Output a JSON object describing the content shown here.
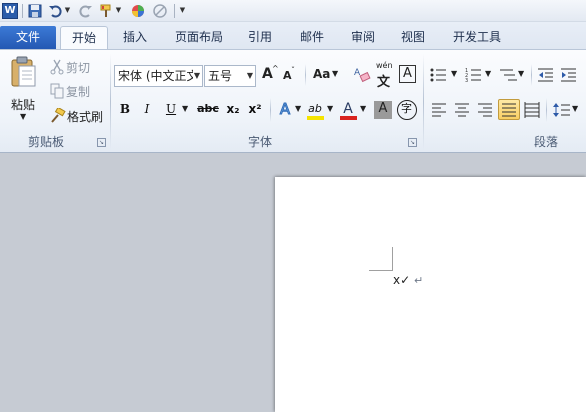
{
  "qat": {
    "app_icon_letter": "W",
    "icons": [
      "word-app-icon",
      "save-icon",
      "undo-icon",
      "redo-icon",
      "format-painter-icon",
      "color-wheel-icon",
      "no-sign-icon",
      "customize-toolbar-icon"
    ]
  },
  "tabs": {
    "file": "文件",
    "home": "开始",
    "insert": "插入",
    "page_layout": "页面布局",
    "references": "引用",
    "mailings": "邮件",
    "review": "审阅",
    "view": "视图",
    "developer": "开发工具"
  },
  "clipboard": {
    "paste": "粘贴",
    "cut": "剪切",
    "copy": "复制",
    "format_painter": "格式刷",
    "group_label": "剪贴板"
  },
  "font": {
    "font_name": "宋体 (中文正文",
    "font_size": "五号",
    "grow": "A",
    "shrink": "A",
    "change_case": "Aa",
    "phonetic": "wén",
    "phonetic_char": "文",
    "char_border": "A",
    "bold": "B",
    "italic": "I",
    "underline": "U",
    "strike": "abc",
    "subscript": "x₂",
    "superscript": "x²",
    "text_effect": "A",
    "highlight": "ab",
    "font_color": "A",
    "shading": "A",
    "enclose": "字",
    "group_label": "字体"
  },
  "paragraph": {
    "group_label": "段落"
  },
  "document": {
    "text": "x✓",
    "paragraph_mark": "↵"
  },
  "colors": {
    "file_tab": "#2458b3",
    "highlight_yellow": "#f5e400",
    "font_color_red": "#d9231f",
    "justify_pressed": "#f8cf63"
  }
}
